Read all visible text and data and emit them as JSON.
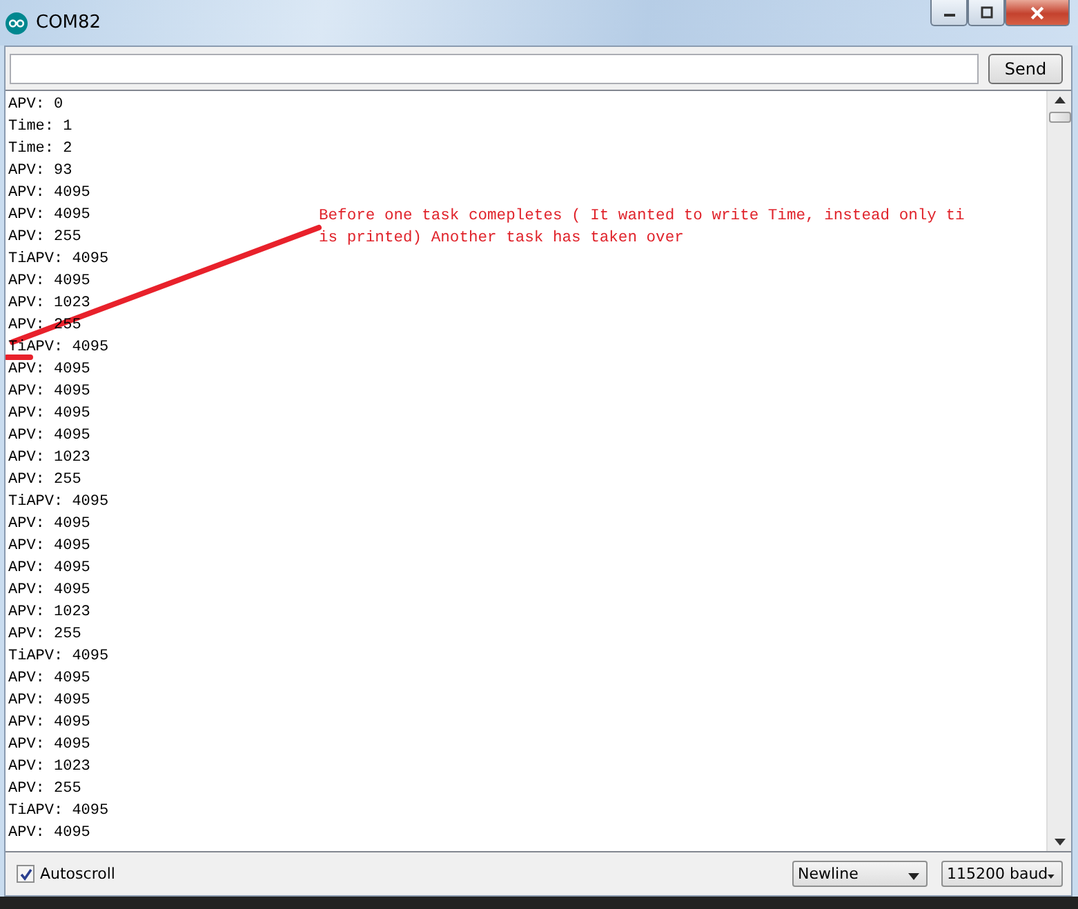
{
  "window": {
    "title": "COM82"
  },
  "input": {
    "send_button": "Send"
  },
  "output_lines": [
    "APV: 0",
    "Time: 1",
    "Time: 2",
    "APV: 93",
    "APV: 4095",
    "APV: 4095",
    "APV: 255",
    "TiAPV: 4095",
    "APV: 4095",
    "APV: 1023",
    "APV: 255",
    "TiAPV: 4095",
    "APV: 4095",
    "APV: 4095",
    "APV: 4095",
    "APV: 4095",
    "APV: 1023",
    "APV: 255",
    "TiAPV: 4095",
    "APV: 4095",
    "APV: 4095",
    "APV: 4095",
    "APV: 4095",
    "APV: 1023",
    "APV: 255",
    "TiAPV: 4095",
    "APV: 4095",
    "APV: 4095",
    "APV: 4095",
    "APV: 4095",
    "APV: 1023",
    "APV: 255",
    "TiAPV: 4095",
    "APV: 4095"
  ],
  "annotation": {
    "text": "Before one task comepletes ( It wanted to write Time, instead only ti is printed) Another task has taken over"
  },
  "status_bar": {
    "autoscroll": {
      "label": "Autoscroll",
      "checked": true
    },
    "line_ending": "Newline",
    "baud_rate": "115200 baud"
  }
}
